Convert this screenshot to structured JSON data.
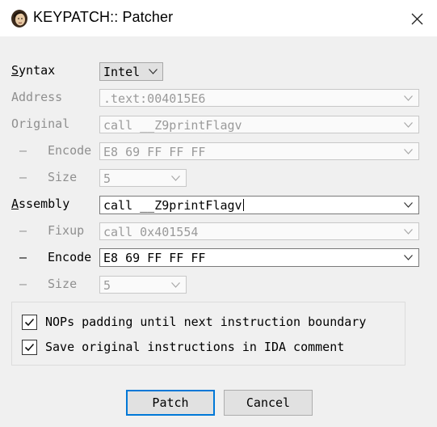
{
  "window": {
    "title": "KEYPATCH:: Patcher"
  },
  "form": {
    "syntax": {
      "label_first": "S",
      "label_rest": "yntax",
      "value": "Intel"
    },
    "address": {
      "label": "Address",
      "value": ".text:004015E6"
    },
    "original": {
      "label": "Original",
      "value": "call __Z9printFlagv"
    },
    "original_encode": {
      "dash": "–",
      "label": "Encode",
      "value": "E8 69 FF FF FF"
    },
    "original_size": {
      "dash": "–",
      "label": "Size",
      "value": "5"
    },
    "assembly": {
      "label_first": "A",
      "label_rest": "ssembly",
      "value": "call __Z9printFlagv"
    },
    "fixup": {
      "dash": "–",
      "label": "Fixup",
      "value": "call 0x401554"
    },
    "assembly_encode": {
      "dash": "–",
      "label": "Encode",
      "value": "E8 69 FF FF FF"
    },
    "assembly_size": {
      "dash": "–",
      "label": "Size",
      "value": "5"
    }
  },
  "options": {
    "nops_padding": {
      "label": "NOPs padding until next instruction boundary",
      "checked": true
    },
    "save_original": {
      "label": "Save original instructions in IDA comment",
      "checked": true
    }
  },
  "buttons": {
    "patch": "Patch",
    "cancel": "Cancel"
  },
  "colors": {
    "accent": "#0078d7",
    "disabled_text": "#8f8f8f"
  }
}
